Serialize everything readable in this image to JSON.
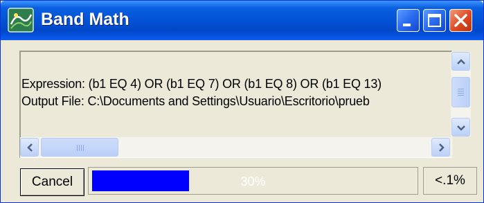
{
  "window": {
    "title": "Band Math",
    "controls": {
      "minimize": "minimize-icon",
      "maximize": "maximize-icon",
      "close": "close-icon"
    }
  },
  "info": {
    "expression_line": "Expression: (b1 EQ 4) OR (b1 EQ 7) OR (b1 EQ 8) OR (b1 EQ 13)",
    "output_line": "Output File: C:\\Documents and Settings\\Usuario\\Escritorio\\prueb"
  },
  "footer": {
    "cancel_label": "Cancel",
    "progress_text": "30%",
    "progress_fraction": 0.3,
    "status_text": "<.1%"
  },
  "colors": {
    "titlebar": "#0454d8",
    "progress_fill": "#0000ff",
    "close_button": "#dd4a22"
  }
}
